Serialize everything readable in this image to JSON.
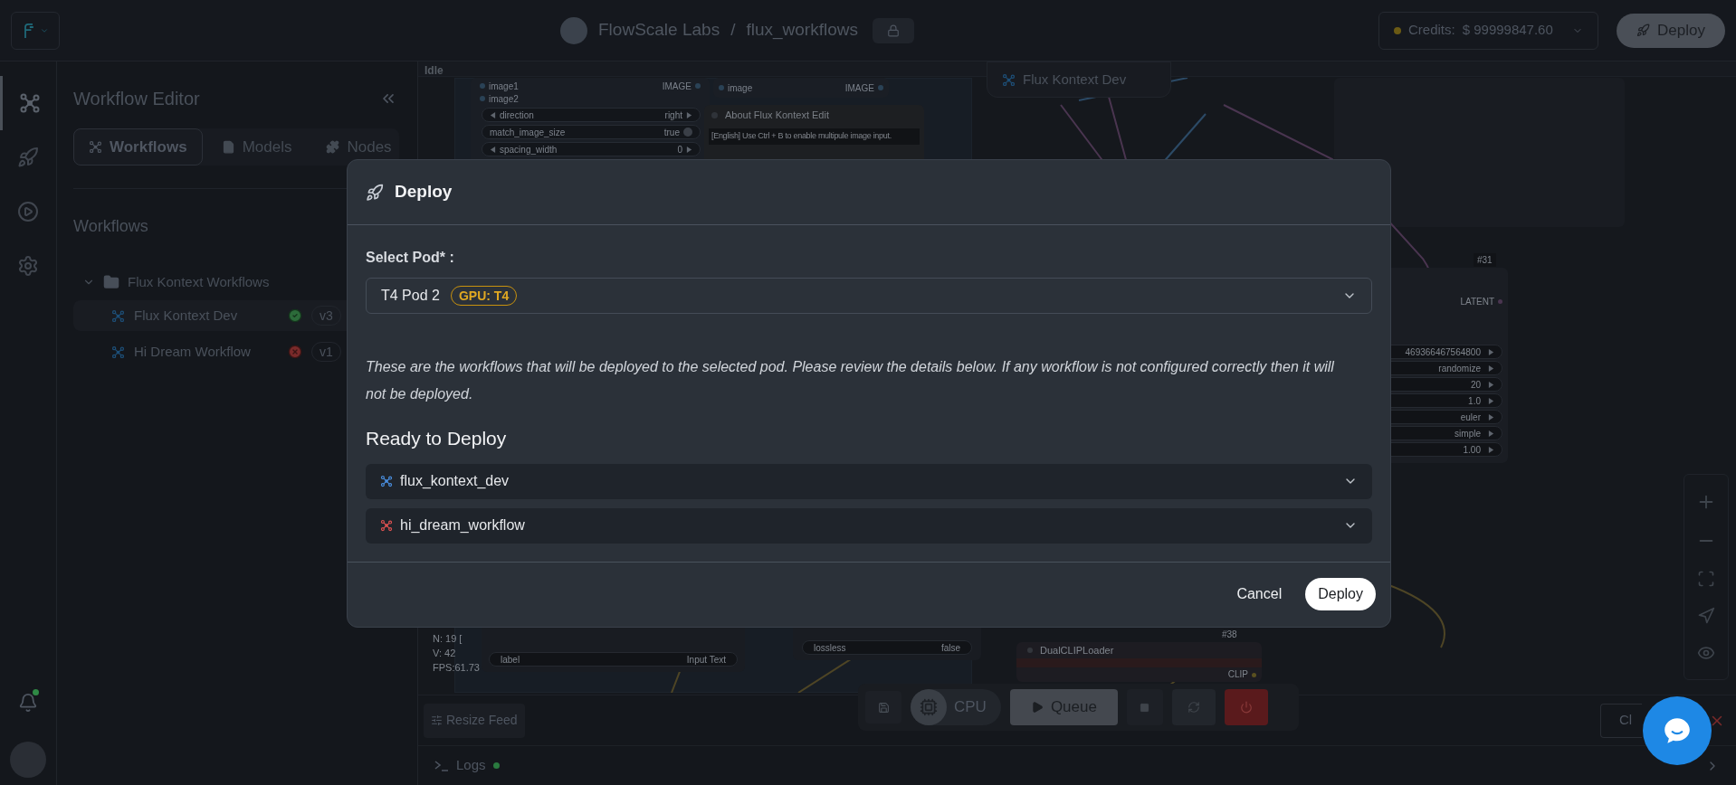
{
  "top_bar": {
    "org": "FlowScale Labs",
    "separator": "/",
    "project": "flux_workflows",
    "credits_label": "Credits:",
    "credits_value": "$ 99999847.60",
    "deploy": "Deploy"
  },
  "nav_rail": [
    {
      "kind": "workflows",
      "selected": true
    },
    {
      "kind": "deploy",
      "selected": false
    },
    {
      "kind": "run",
      "selected": false
    },
    {
      "kind": "settings",
      "selected": false
    }
  ],
  "sidebar": {
    "title": "Workflow Editor",
    "tabs": [
      {
        "label": "Workflows",
        "kind": "workflows",
        "selected": true
      },
      {
        "label": "Models",
        "kind": "models",
        "selected": false
      },
      {
        "label": "Nodes",
        "kind": "nodes",
        "selected": false
      }
    ],
    "section_title": "Workflows",
    "tree": [
      {
        "label": "Flux Kontext Workflows",
        "expanded": true,
        "children": [
          {
            "label": "Flux Kontext Dev",
            "kind": "ok",
            "version": "v3",
            "selected": true
          },
          {
            "label": "Hi Dream Workflow",
            "kind": "error",
            "version": "v1",
            "selected": false
          }
        ]
      }
    ]
  },
  "canvas": {
    "status": "Idle",
    "floating_tab": "Flux Kontext Dev",
    "stitch_node": {
      "inputs": [
        "image1",
        "image2"
      ],
      "output": "IMAGE",
      "widgets": [
        {
          "name": "direction",
          "value": "right",
          "kind": "combo"
        },
        {
          "name": "match_image_size",
          "value": "true",
          "kind": "toggle"
        },
        {
          "name": "spacing_width",
          "value": "0",
          "kind": "combo"
        }
      ]
    },
    "image_node": {
      "input": "image",
      "output": "IMAGE"
    },
    "note_node": {
      "title": "About Flux Kontext Edit",
      "text": "[English] Use Ctrl + B to enable multipule image input."
    },
    "sampler_node": {
      "badge": "#31",
      "output": "LATENT",
      "values": [
        "469366467564800",
        "randomize",
        "20",
        "1.0",
        "euler",
        "simple",
        "1.00"
      ]
    },
    "stats": [
      "N: 19 [",
      "V: 42",
      "FPS:61.73"
    ],
    "text_node": {
      "widget": "label",
      "value": "Input Text"
    },
    "save_node": {
      "widget": "lossless",
      "value": "false"
    },
    "clip_node": {
      "title": "DualCLIPLoader",
      "badge": "#38",
      "output": "CLIP"
    }
  },
  "toolbar": {
    "resize_feed": "Resize Feed",
    "device": "CPU",
    "queue": "Queue",
    "close_partial": "Cl",
    "logs": "Logs"
  },
  "deploy_dialog": {
    "title": "Deploy",
    "pod_label": "Select Pod* :",
    "pod_name": "T4 Pod 2",
    "pod_badge": "GPU: T4",
    "note": "These are the workflows that will be deployed to the selected pod. Please review the details below. If any workflow is not configured correctly then it will not be deployed.",
    "section_title": "Ready to Deploy",
    "workflows": [
      {
        "name": "flux_kontext_dev",
        "color": "#4a90e2"
      },
      {
        "name": "hi_dream_workflow",
        "color": "#e05252"
      }
    ],
    "cancel": "Cancel",
    "confirm": "Deploy"
  }
}
